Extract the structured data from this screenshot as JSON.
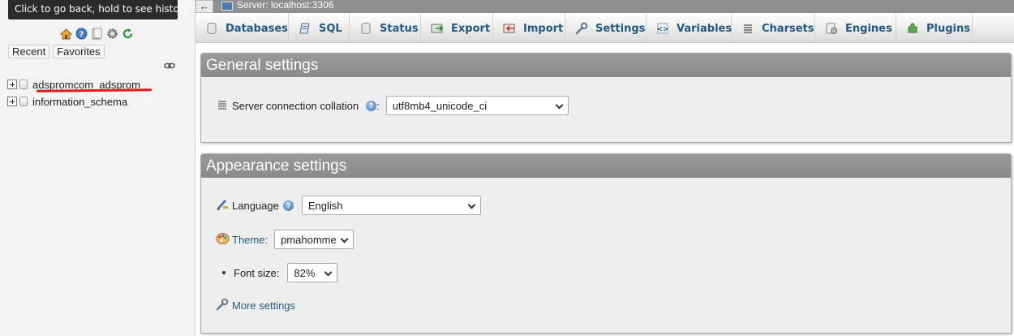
{
  "tooltip": "Click to go back, hold to see history",
  "nav": {
    "icons": [
      "home-icon",
      "help-icon",
      "docs-icon",
      "settings-icon",
      "reload-icon"
    ],
    "tabs": [
      "Recent",
      "Favorites"
    ],
    "databases": [
      {
        "name": "adspromcom_adsprom",
        "highlighted": true
      },
      {
        "name": "information_schema",
        "highlighted": false
      }
    ]
  },
  "header": {
    "back_symbol": "←",
    "server_label": "Server: localhost:3306"
  },
  "menu": {
    "tabs": [
      {
        "label": "Databases",
        "icon": "database-icon"
      },
      {
        "label": "SQL",
        "icon": "sql-icon"
      },
      {
        "label": "Status",
        "icon": "status-icon"
      },
      {
        "label": "Export",
        "icon": "export-icon"
      },
      {
        "label": "Import",
        "icon": "import-icon"
      },
      {
        "label": "Settings",
        "icon": "wrench-icon"
      },
      {
        "label": "Variables",
        "icon": "variables-icon"
      },
      {
        "label": "Charsets",
        "icon": "charsets-icon"
      },
      {
        "label": "Engines",
        "icon": "engines-icon"
      },
      {
        "label": "Plugins",
        "icon": "plugin-icon"
      }
    ]
  },
  "general": {
    "title": "General settings",
    "collation_label": "Server connection collation",
    "collation_suffix": ":",
    "collation_value": "utf8mb4_unicode_ci",
    "help_symbol": "?"
  },
  "appearance": {
    "title": "Appearance settings",
    "language_label": "Language",
    "language_value": "English",
    "theme_label": "Theme:",
    "theme_value": "pmahomme",
    "fontsize_label": "Font size:",
    "fontsize_value": "82%",
    "more_settings": "More settings",
    "help_symbol": "?"
  },
  "colors": {
    "link": "#235a81",
    "panel_header": "#8f8f8f",
    "highlight_underline": "#e01b1b"
  }
}
